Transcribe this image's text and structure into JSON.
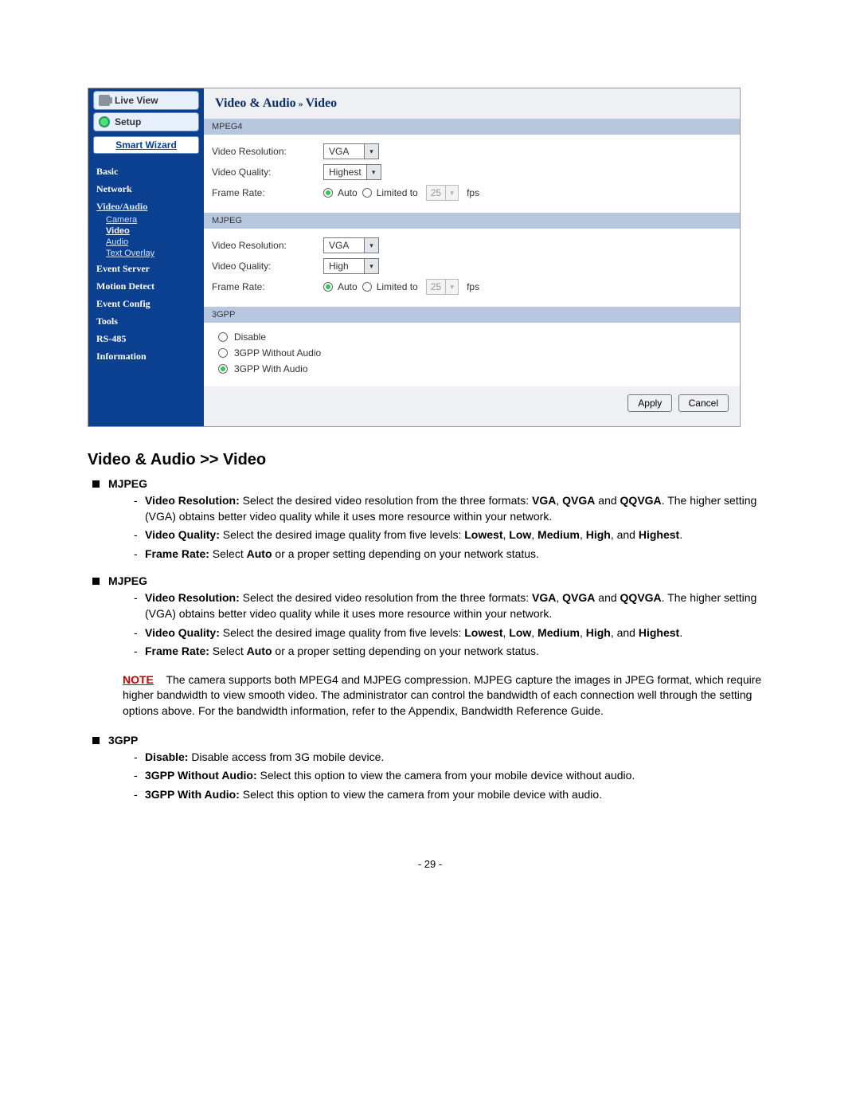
{
  "ui": {
    "sidebar": {
      "live_view": "Live View",
      "setup": "Setup",
      "smart_wizard": "Smart Wizard",
      "categories": {
        "basic": "Basic",
        "network": "Network",
        "video_audio": "Video/Audio",
        "event_server": "Event Server",
        "motion_detect": "Motion Detect",
        "event_config": "Event Config",
        "tools": "Tools",
        "rs485": "RS-485",
        "information": "Information"
      },
      "video_audio_sub": {
        "camera": "Camera",
        "video": "Video",
        "audio": "Audio",
        "text_overlay": "Text Overlay"
      }
    },
    "content": {
      "title_main": "Video & Audio",
      "title_sep": " » ",
      "title_sub": "Video",
      "mpeg4": {
        "head": "MPEG4",
        "res_label": "Video Resolution:",
        "res_value": "VGA",
        "qual_label": "Video Quality:",
        "qual_value": "Highest",
        "rate_label": "Frame Rate:",
        "auto": "Auto",
        "limited": "Limited to",
        "fps_value": "25",
        "fps_unit": "fps"
      },
      "mjpeg": {
        "head": "MJPEG",
        "res_label": "Video Resolution:",
        "res_value": "VGA",
        "qual_label": "Video Quality:",
        "qual_value": "High",
        "rate_label": "Frame Rate:",
        "auto": "Auto",
        "limited": "Limited to",
        "fps_value": "25",
        "fps_unit": "fps"
      },
      "gpp": {
        "head": "3GPP",
        "disable": "Disable",
        "without": "3GPP Without Audio",
        "with": "3GPP With Audio"
      },
      "apply": "Apply",
      "cancel": "Cancel"
    }
  },
  "doc": {
    "heading": "Video & Audio >> Video",
    "mjpeg_title_1": "MJPEG",
    "mjpeg_title_2": "MJPEG",
    "gpp_title": "3GPP",
    "res_label": "Video Resolution:",
    "res_text_a": " Select the desired video resolution from the three formats: ",
    "res_vga": "VGA",
    "res_qvga": "QVGA",
    "res_and": " and ",
    "res_qqvga": "QQVGA",
    "res_text_b": ". The higher setting (VGA) obtains better video quality while it uses more resource within your network.",
    "qual_label": "Video Quality:",
    "qual_text_a": " Select the desired image quality from five levels: ",
    "qual_lowest": "Lowest",
    "qual_low": "Low",
    "qual_medium": "Medium",
    "qual_high": "High",
    "qual_and": ", and ",
    "qual_highest": "Highest",
    "qual_period": ".",
    "rate_label": "Frame Rate:",
    "rate_text_a": " Select ",
    "rate_auto": "Auto",
    "rate_text_b": " or a proper setting depending on your network status.",
    "note_label": "NOTE",
    "note_text": "The camera supports both MPEG4 and MJPEG compression. MJPEG capture the images in JPEG format, which require higher bandwidth to view smooth video. The administrator can control the bandwidth of each connection well through the setting options above. For the bandwidth information, refer to the Appendix, Bandwidth Reference Guide.",
    "gpp_disable_label": "Disable:",
    "gpp_disable_text": " Disable access from 3G mobile device.",
    "gpp_without_label": "3GPP Without Audio:",
    "gpp_without_text": " Select this option to view the camera from your mobile device without audio.",
    "gpp_with_label": "3GPP With Audio:",
    "gpp_with_text": " Select this option to view the camera from your mobile device with audio.",
    "page_number": "- 29 -"
  }
}
